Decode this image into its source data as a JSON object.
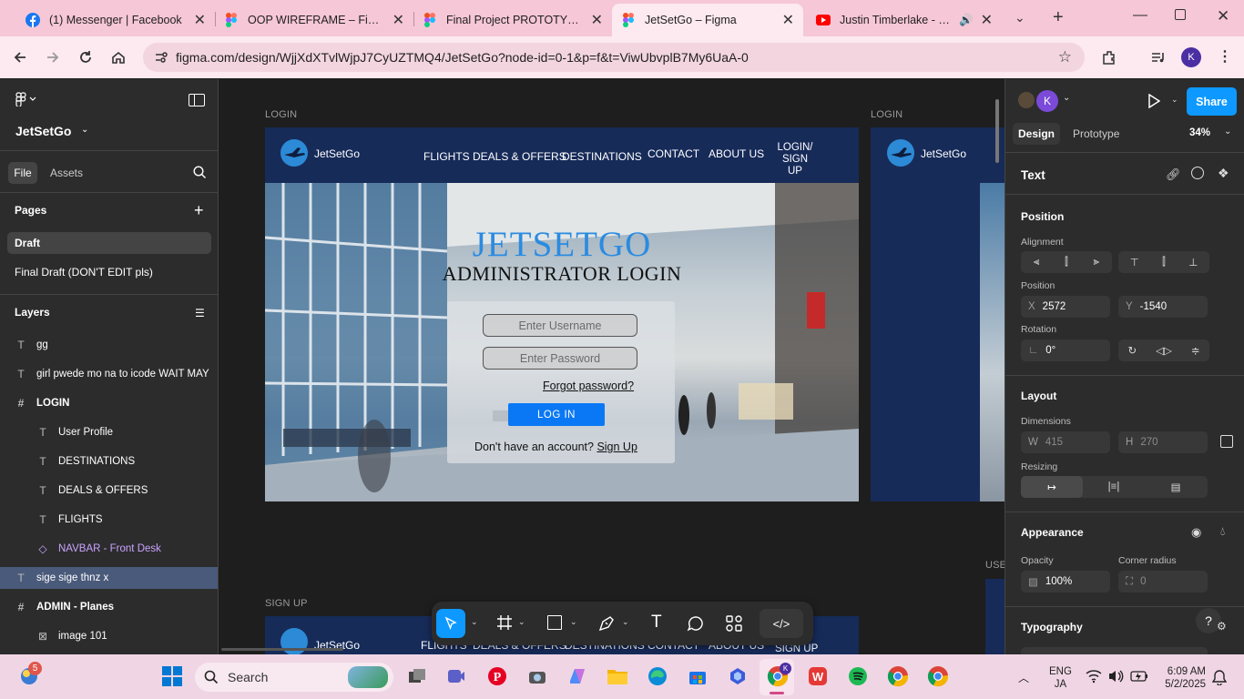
{
  "browser": {
    "tabs": [
      {
        "title": "(1) Messenger | Facebook",
        "icon": "facebook-icon"
      },
      {
        "title": "OOP WIREFRAME – Figma",
        "icon": "figma-icon"
      },
      {
        "title": "Final Project PROTOTYPE – F",
        "icon": "figma-icon"
      },
      {
        "title": "JetSetGo – Figma",
        "icon": "figma-icon",
        "active": true
      },
      {
        "title": "Justin Timberlake - Mirr",
        "icon": "youtube-icon"
      }
    ],
    "url": "figma.com/design/WjjXdXTvlWjpJ7CyUZTMQ4/JetSetGo?node-id=0-1&p=f&t=ViwUbvplB7My6UaA-0",
    "profile_initial": "K",
    "colors": {
      "tabbar": "#f6c7d6",
      "toolbar": "#fde9f0"
    }
  },
  "figma": {
    "file_name": "JetSetGo",
    "left_tabs": {
      "file": "File",
      "assets": "Assets"
    },
    "pages_title": "Pages",
    "pages": [
      "Draft",
      "Final Draft (DON'T EDIT pls)"
    ],
    "layers_title": "Layers",
    "layers": [
      {
        "name": "gg",
        "icon": "text-icon",
        "indent": 0
      },
      {
        "name": "girl pwede mo na to icode  WAIT MAY",
        "icon": "text-icon",
        "indent": 0
      },
      {
        "name": "LOGIN",
        "icon": "frame-icon",
        "indent": 0
      },
      {
        "name": "User Profile",
        "icon": "text-icon",
        "indent": 1
      },
      {
        "name": "DESTINATIONS",
        "icon": "text-icon",
        "indent": 1
      },
      {
        "name": "DEALS & OFFERS",
        "icon": "text-icon",
        "indent": 1
      },
      {
        "name": "FLIGHTS",
        "icon": "text-icon",
        "indent": 1
      },
      {
        "name": "NAVBAR - Front Desk",
        "icon": "component-icon",
        "indent": 1,
        "purple": true
      },
      {
        "name": "sige sige thnz x",
        "icon": "text-icon",
        "indent": 0,
        "selected": true
      },
      {
        "name": "ADMIN - Planes",
        "icon": "frame-icon",
        "indent": 0
      },
      {
        "name": "image 101",
        "icon": "image-icon",
        "indent": 1
      }
    ]
  },
  "canvas": {
    "label_login": "LOGIN",
    "label_login2": "LOGIN",
    "label_signup": "SIGN UP",
    "label_user": "USE",
    "nav": {
      "brand": "JetSetGo",
      "links": [
        "FLIGHTS",
        "DEALS & OFFERS",
        "DESTINATIONS",
        "CONTACT",
        "ABOUT US"
      ],
      "login_signup_1": "LOGIN/",
      "login_signup_2": "SIGN UP"
    },
    "login_title": "JETSETGO",
    "login_subtitle": "ADMINISTRATOR LOGIN",
    "username_placeholder": "Enter  Username",
    "password_placeholder": "Enter  Password",
    "forgot": "Forgot password?",
    "login_button": "LOG IN",
    "no_account": "Don't have an account?",
    "sign_up": "Sign Up",
    "signup_nav_links": [
      "FLIGHTS",
      "DEALS & OFFERS",
      "DESTINATIONS",
      "CONTACT",
      "ABOUT US"
    ],
    "signup_nav_last": "SIGN UP"
  },
  "right_panel": {
    "share": "Share",
    "avatar_initial": "K",
    "tab_design": "Design",
    "tab_prototype": "Prototype",
    "zoom": "34%",
    "selection_type": "Text",
    "position_title": "Position",
    "alignment_label": "Alignment",
    "position_label": "Position",
    "x_key": "X",
    "x": "2572",
    "y_key": "Y",
    "y": "-1540",
    "rotation_label": "Rotation",
    "rotation": "0°",
    "layout_title": "Layout",
    "dimensions_label": "Dimensions",
    "w_key": "W",
    "w": "415",
    "h_key": "H",
    "h": "270",
    "resizing_label": "Resizing",
    "appearance_title": "Appearance",
    "opacity_label": "Opacity",
    "opacity": "100%",
    "corner_label": "Corner radius",
    "corner": "0",
    "typography_title": "Typography",
    "help": "?"
  },
  "taskbar": {
    "search": "Search",
    "notification_count": "5",
    "lang_1": "ENG",
    "lang_2": "JA",
    "time": "6:09 AM",
    "date": "5/2/2025"
  }
}
